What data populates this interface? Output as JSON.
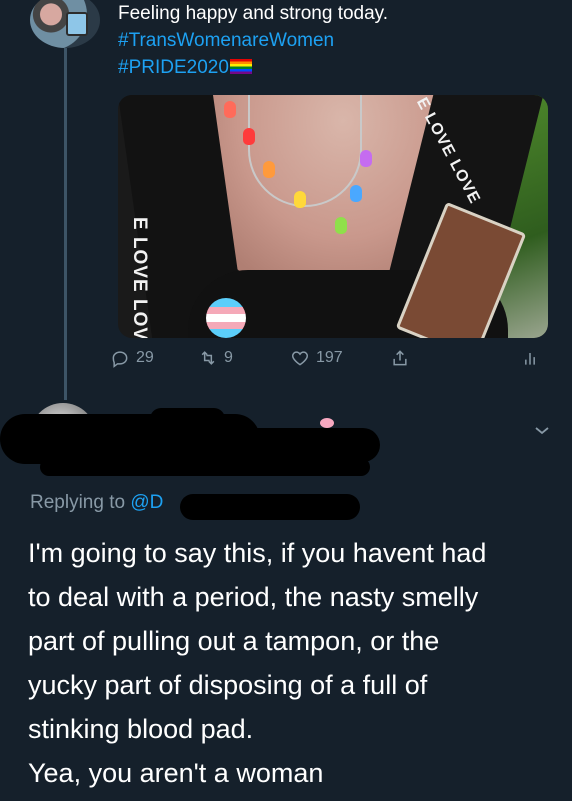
{
  "first_tweet": {
    "text_line1": "Feeling happy and strong today.",
    "hashtag1": "#TransWomenareWomen",
    "hashtag2": "#PRIDE2020",
    "flag_icon": "rainbow-flag-icon",
    "photo_strap_left": "E LOVE LOVE LOVE LO",
    "photo_strap_right": "E LOVE LOVE",
    "actions": {
      "reply_count": "29",
      "retweet_count": "9",
      "like_count": "197"
    }
  },
  "second_tweet": {
    "replying_label": "Replying to",
    "replying_handle": "@D",
    "body_lines": [
      "I'm going to say this, if you havent had",
      "to deal with a period, the nasty smelly",
      "part of pulling out a tampon, or the",
      "yucky part of disposing of a full of",
      "stinking blood pad.",
      "Yea, you aren't a woman"
    ]
  },
  "colors": {
    "background": "#15202b",
    "link": "#1da1f2",
    "muted": "#8899a6",
    "thread_line": "#3d5466"
  }
}
